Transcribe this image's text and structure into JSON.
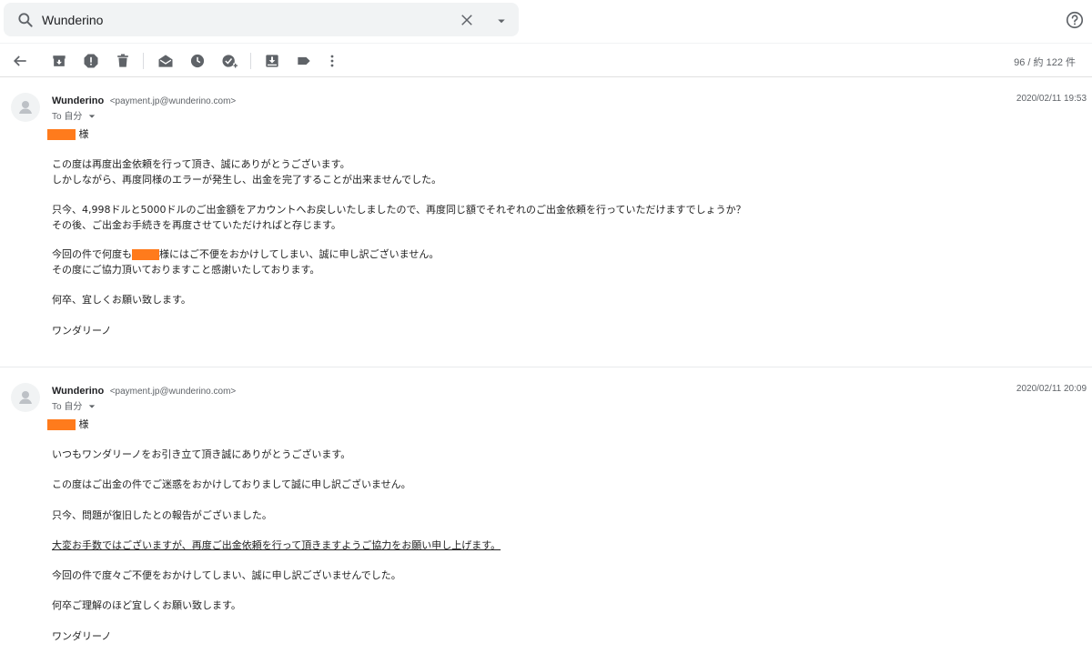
{
  "search": {
    "query": "Wunderino"
  },
  "toolbar": {
    "counter": "96 / 約 122 件"
  },
  "colors": {
    "redaction": "#ff7b1c"
  },
  "messages": [
    {
      "sender_name": "Wunderino",
      "sender_email": "<payment.jp@wunderino.com>",
      "to_label": "To 自分",
      "timestamp": "2020/02/11 19:53",
      "salutation_suffix": "様",
      "lines": [
        "この度は再度出金依頼を行って頂き、誠にありがとうございます。",
        "しかしながら、再度同様のエラーが発生し、出金を完了することが出来ませんでした。",
        "只今、4,998ドルと5000ドルのご出金額をアカウントへお戻しいたしましたので、再度同じ額でそれぞれのご出金依頼を行っていただけますでしょうか？",
        "その後、ご出金お手続きを再度させていただければと存じます。",
        "今回の件で何度も",
        "様にはご不便をおかけしてしまい、誠に申し訳ございません。",
        "その度にご協力頂いておりますこと感謝いたしております。",
        "何卒、宜しくお願い致します。",
        "ワンダリーノ"
      ]
    },
    {
      "sender_name": "Wunderino",
      "sender_email": "<payment.jp@wunderino.com>",
      "to_label": "To 自分",
      "timestamp": "2020/02/11 20:09",
      "salutation_suffix": "様",
      "lines": [
        "いつもワンダリーノをお引き立て頂き誠にありがとうございます。",
        "この度はご出金の件でご迷惑をおかけしておりまして誠に申し訳ございません。",
        "只今、問題が復旧したとの報告がございました。",
        "大変お手数ではございますが、再度ご出金依頼を行って頂きますようご協力をお願い申し上げます。",
        "今回の件で度々ご不便をおかけしてしまい、誠に申し訳ございませんでした。",
        "何卒ご理解のほど宜しくお願い致します。",
        "ワンダリーノ"
      ]
    }
  ]
}
